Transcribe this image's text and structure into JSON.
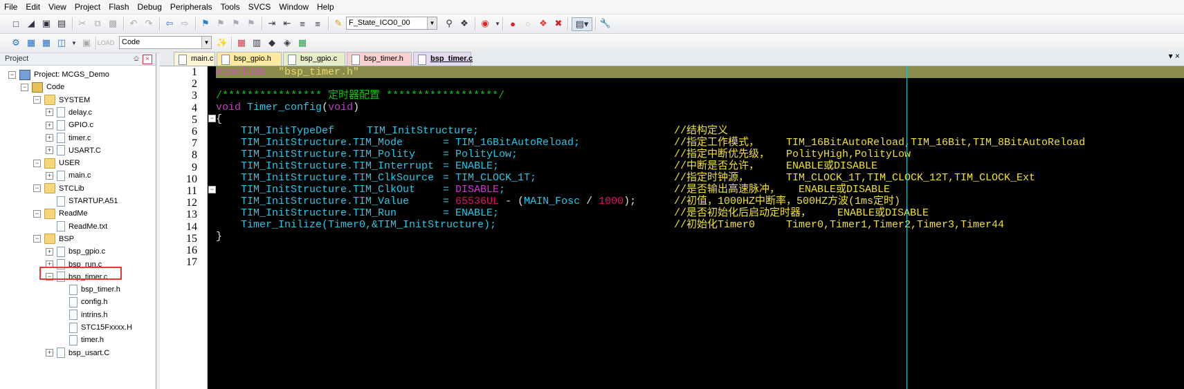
{
  "menu": [
    "File",
    "Edit",
    "View",
    "Project",
    "Flash",
    "Debug",
    "Peripherals",
    "Tools",
    "SVCS",
    "Window",
    "Help"
  ],
  "toolbar": {
    "target_combo": "F_State_ICO0_00",
    "group_combo": "Code"
  },
  "project_panel": {
    "title": "Project",
    "pin": "⎐",
    "close": "×"
  },
  "tree": [
    {
      "label": "Project: MCGS_Demo",
      "level": 0,
      "icon": "proj",
      "exp": "−"
    },
    {
      "label": "Code",
      "level": 1,
      "icon": "group",
      "exp": "−"
    },
    {
      "label": "SYSTEM",
      "level": 2,
      "icon": "folder",
      "exp": "−"
    },
    {
      "label": "delay.c",
      "level": 3,
      "icon": "file",
      "exp": "+"
    },
    {
      "label": "GPIO.c",
      "level": 3,
      "icon": "file",
      "exp": "+"
    },
    {
      "label": "timer.c",
      "level": 3,
      "icon": "file",
      "exp": "+"
    },
    {
      "label": "USART.C",
      "level": 3,
      "icon": "file",
      "exp": "+"
    },
    {
      "label": "USER",
      "level": 2,
      "icon": "folder",
      "exp": "−"
    },
    {
      "label": "main.c",
      "level": 3,
      "icon": "file",
      "exp": "+"
    },
    {
      "label": "STCLib",
      "level": 2,
      "icon": "folder",
      "exp": "−"
    },
    {
      "label": "STARTUP.A51",
      "level": 3,
      "icon": "file",
      "exp": ""
    },
    {
      "label": "ReadMe",
      "level": 2,
      "icon": "folder",
      "exp": "−"
    },
    {
      "label": "ReadMe.txt",
      "level": 3,
      "icon": "file",
      "exp": ""
    },
    {
      "label": "BSP",
      "level": 2,
      "icon": "folder",
      "exp": "−"
    },
    {
      "label": "bsp_gpio.c",
      "level": 3,
      "icon": "file",
      "exp": "+"
    },
    {
      "label": "bsp_run.c",
      "level": 3,
      "icon": "file",
      "exp": "+"
    },
    {
      "label": "bsp_timer.c",
      "level": 3,
      "icon": "file",
      "exp": "−"
    },
    {
      "label": "bsp_timer.h",
      "level": 4,
      "icon": "file",
      "exp": ""
    },
    {
      "label": "config.h",
      "level": 4,
      "icon": "file",
      "exp": ""
    },
    {
      "label": "intrins.h",
      "level": 4,
      "icon": "file",
      "exp": ""
    },
    {
      "label": "STC15Fxxxx.H",
      "level": 4,
      "icon": "file",
      "exp": ""
    },
    {
      "label": "timer.h",
      "level": 4,
      "icon": "file",
      "exp": ""
    },
    {
      "label": "bsp_usart.C",
      "level": 3,
      "icon": "file",
      "exp": "+"
    }
  ],
  "tabs": [
    {
      "label": "main.c",
      "bg": "#fdf5d5"
    },
    {
      "label": "bsp_gpio.h",
      "bg": "#fde9a0"
    },
    {
      "label": "bsp_gpio.c",
      "bg": "#e6eec9"
    },
    {
      "label": "bsp_timer.h",
      "bg": "#f7d0d0"
    },
    {
      "label": "bsp_timer.c",
      "bg": "#e3daf1"
    }
  ],
  "tab_controls": "▾   ×",
  "line_numbers": [
    "1",
    "2",
    "3",
    "4",
    "5",
    "6",
    "7",
    "8",
    "9",
    "10",
    "11",
    "12",
    "13",
    "14",
    "15",
    "16",
    "17"
  ],
  "code": {
    "l1_inc": "#include",
    "l1_str": "\"bsp_timer.h\"",
    "l3": "/**************** 定时器配置 ******************/",
    "l4_kw": "void",
    "l4_name": "Timer_config",
    "l4_open": "(",
    "l4_arg": "void",
    "l4_close": ")",
    "l5": "{",
    "l6_a": "TIM_InitTypeDef",
    "l6_b": "TIM_InitStructure;",
    "l6_c": "//结构定义",
    "l7_a": "TIM_InitStructure.TIM_Mode",
    "l7_b": "= TIM_16BitAutoReload;",
    "l7_c": "//指定工作模式，",
    "l7_d": "TIM_16BitAutoReload,TIM_16Bit,TIM_8BitAutoReload",
    "l8_a": "TIM_InitStructure.TIM_Polity",
    "l8_b": "= PolityLow;",
    "l8_c": "//指定中断优先级，",
    "l8_d": "PolityHigh,PolityLow",
    "l9_a": "TIM_InitStructure.TIM_Interrupt",
    "l9_b": "= ENABLE;",
    "l9_c": "//中断是否允许，",
    "l9_d": "ENABLE或DISABLE",
    "l10_a": "TIM_InitStructure.TIM_ClkSource",
    "l10_b": "= TIM_CLOCK_1T;",
    "l10_c": "//指定时钟源，",
    "l10_d": "TIM_CLOCK_1T,TIM_CLOCK_12T,TIM_CLOCK_Ext",
    "l11_a": "TIM_InitStructure.TIM_ClkOut",
    "l11_eq": "=",
    "l11_b": "DISABLE",
    "l11_semi": ";",
    "l11_c": "//是否输出高速脉冲，",
    "l11_d": "ENABLE或DISABLE",
    "l12_a": "TIM_InitStructure.TIM_Value",
    "l12_eq": "=",
    "l12_n1": "65536UL",
    "l12_minus": "- (",
    "l12_mac": "MAIN_Fosc",
    "l12_div": "/",
    "l12_n2": "1000",
    "l12_end": ");",
    "l12_c": "//初值，1000HZ中断率，500HZ方波(1ms定时)",
    "l13_a": "TIM_InitStructure.TIM_Run",
    "l13_b": "= ENABLE;",
    "l13_c": "//是否初始化后启动定时器，",
    "l13_d": "ENABLE或DISABLE",
    "l14_a": "Timer_Inilize(Timer0,&TIM_InitStructure);",
    "l14_c": "//初始化Timer0",
    "l14_d": "Timer0,Timer1,Timer2,Timer3,Timer44",
    "l15": "}"
  }
}
